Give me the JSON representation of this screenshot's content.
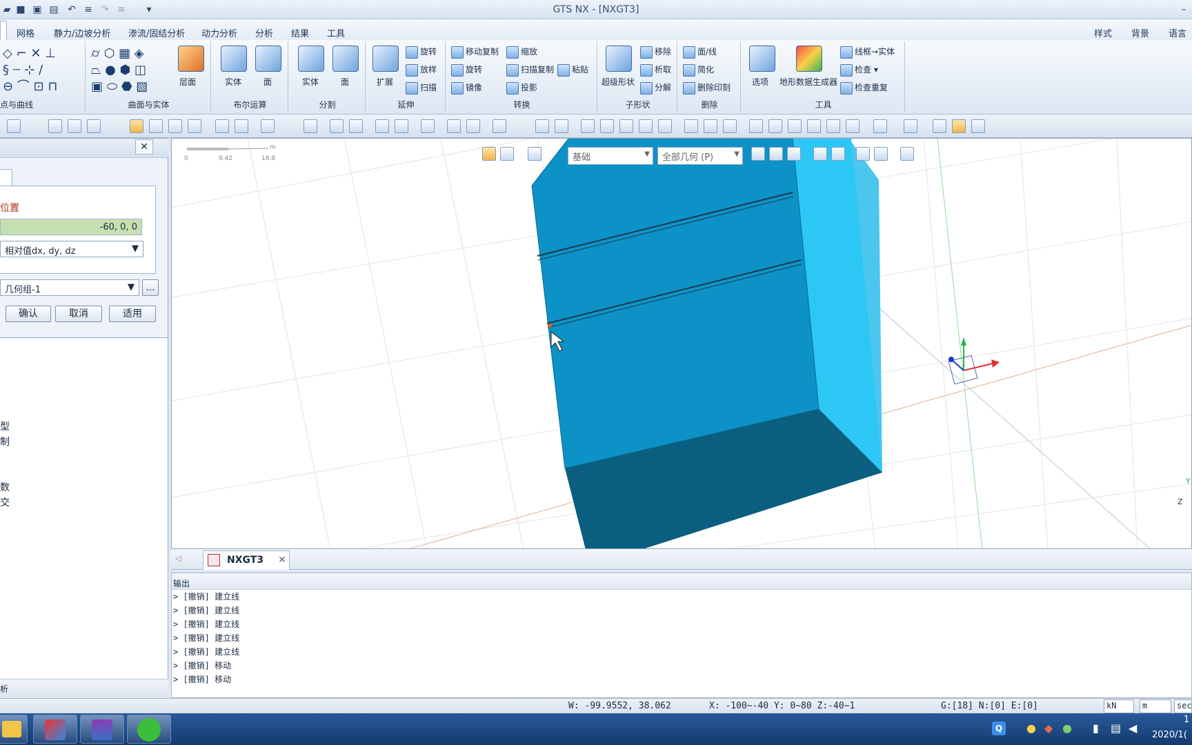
{
  "app": {
    "title": "GTS NX - [NXGT3]"
  },
  "menu": [
    "网格",
    "静力/边坡分析",
    "渗流/固结分析",
    "动力分析",
    "分析",
    "结果",
    "工具"
  ],
  "menu_right": [
    "样式",
    "背景",
    "语言"
  ],
  "ribbon": {
    "groups": [
      "点与曲线",
      "曲面与实体",
      "布尔运算",
      "分割",
      "延伸",
      "转换",
      "子形状",
      "删除",
      "工具"
    ],
    "surface_big": "层面",
    "bool": [
      "实体",
      "面"
    ],
    "split": [
      "实体",
      "面"
    ],
    "extend": {
      "big": "扩展",
      "items": [
        "旋转",
        "放样",
        "扫描"
      ]
    },
    "transform": [
      "移动复制",
      "缩放",
      "旋转",
      "扫描复制",
      "粘贴",
      "镜像",
      "投影"
    ],
    "subshape": {
      "big": "超级形状",
      "items": [
        "移除",
        "析取",
        "分解"
      ]
    },
    "delete": [
      "面/线",
      "简化",
      "删除印刻"
    ],
    "tools": {
      "items": [
        "选项",
        "地形数据生成器"
      ],
      "small": [
        "线框→实体",
        "检查",
        "检查重复"
      ]
    }
  },
  "dialog": {
    "position_label": "位置",
    "coord_value": "-60, 0, 0",
    "mode_value": "相对值dx, dy, dz",
    "group_value": "几何组-1",
    "ellipsis": "...",
    "ok": "确认",
    "cancel": "取消",
    "apply": "适用"
  },
  "tree_fragments": [
    "型",
    "制",
    "数",
    "交"
  ],
  "panel_bottom": "析",
  "viewport": {
    "scale": [
      "0",
      "9.42",
      "18.8",
      "m"
    ],
    "combo_base": "基础",
    "combo_geom": "全部几何 (P)",
    "axis": {
      "y": "Y",
      "z": "Z"
    }
  },
  "doc_tab": "NXGT3",
  "output": {
    "header": "输出",
    "lines": [
      "> [撤销] 建立线",
      "> [撤销] 建立线",
      "> [撤销] 建立线",
      "> [撤销] 建立线",
      "> [撤销] 建立线",
      "> [撤销] 移动",
      "> [撤销] 移动"
    ]
  },
  "status": {
    "w": "W: -99.9552, 38.062",
    "range": "X: -100~-40 Y: 0~80 Z:-40~1",
    "counts": "G:[18] N:[0] E:[0]",
    "unit_force": "kN",
    "unit_len": "m",
    "unit_time": "sec"
  },
  "taskbar": {
    "time": "1",
    "date": "2020/1("
  }
}
